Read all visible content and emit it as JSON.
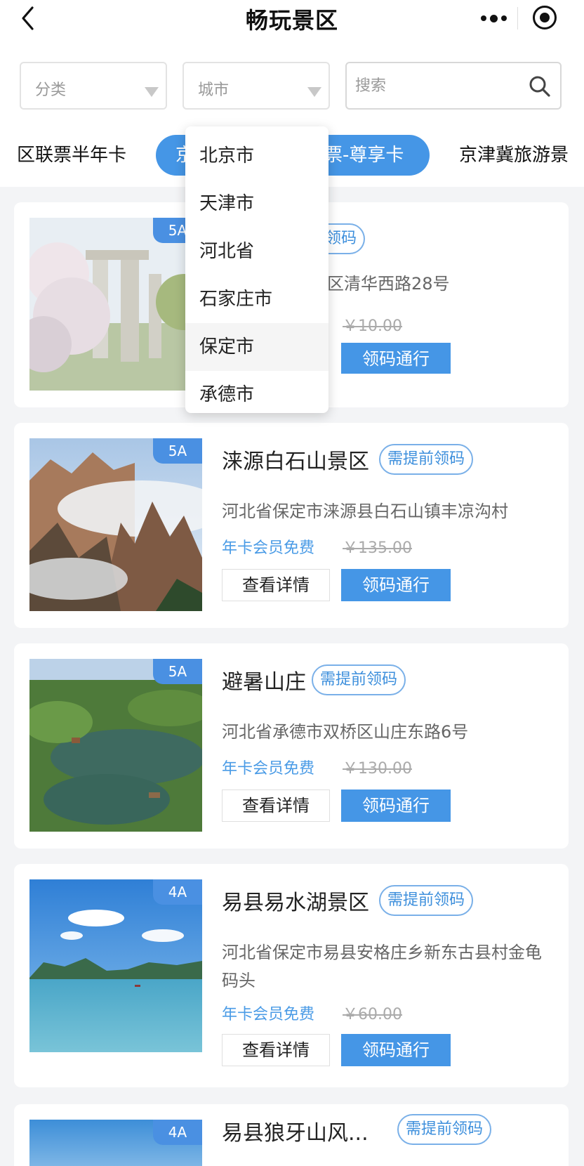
{
  "header": {
    "title": "畅玩景区"
  },
  "filters": {
    "category_label": "分类",
    "city_label": "城市",
    "search_placeholder": "搜索"
  },
  "tabs": [
    "区联票半年卡",
    "京",
    "票-尊享卡",
    "京津冀旅游景"
  ],
  "city_dropdown": {
    "options": [
      "北京市",
      "天津市",
      "河北省",
      "石家庄市",
      "保定市",
      "承德市"
    ],
    "highlighted": "保定市"
  },
  "cards": [
    {
      "grade": "5A",
      "name": "",
      "tag": "需提前领码",
      "tag_partial": "前领码",
      "address_partial": "区清华西路28号",
      "member_text": "",
      "price": "￥10.00",
      "detail_label": "",
      "pass_label": "领码通行"
    },
    {
      "grade": "5A",
      "name": "涞源白石山景区",
      "tag": "需提前领码",
      "address": "河北省保定市涞源县白石山镇丰凉沟村",
      "member_text": "年卡会员免费",
      "price": "￥135.00",
      "detail_label": "查看详情",
      "pass_label": "领码通行"
    },
    {
      "grade": "5A",
      "name": "避暑山庄",
      "tag": "需提前领码",
      "address": "河北省承德市双桥区山庄东路6号",
      "member_text": "年卡会员免费",
      "price": "￥130.00",
      "detail_label": "查看详情",
      "pass_label": "领码通行"
    },
    {
      "grade": "4A",
      "name": "易县易水湖景区",
      "tag": "需提前领码",
      "address": "河北省保定市易县安格庄乡新东古县村金龟码头",
      "member_text": "年卡会员免费",
      "price": "￥60.00",
      "detail_label": "查看详情",
      "pass_label": "领码通行"
    },
    {
      "grade": "4A",
      "name": "易县狼牙山风...",
      "tag": "需提前领码"
    }
  ],
  "colors": {
    "accent": "#4596e6",
    "member_text": "#4a9be6",
    "grade_badge": "#4a90e2"
  }
}
